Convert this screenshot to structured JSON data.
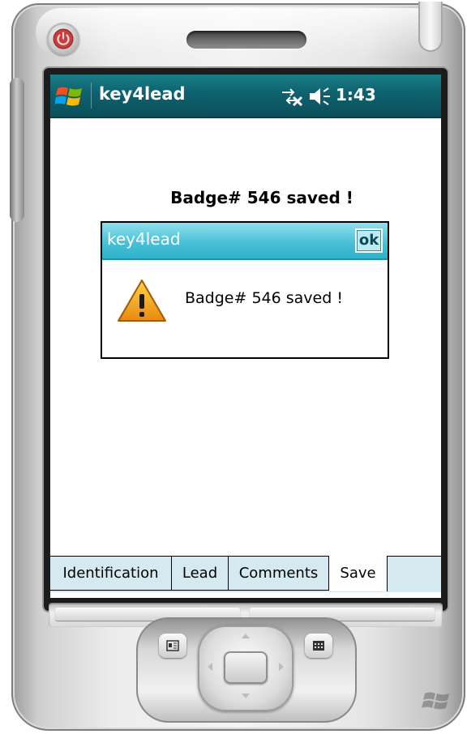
{
  "status_bar": {
    "app_title": "key4lead",
    "time": "1:43",
    "icons": [
      "windows-start-icon",
      "connectivity-icon",
      "volume-icon"
    ]
  },
  "main": {
    "headline": "Badge# 546 saved !"
  },
  "dialog": {
    "title": "key4lead",
    "ok_label": "ok",
    "message": "Badge# 546 saved !",
    "icon": "warning-icon"
  },
  "tabs": [
    {
      "label": "Identification",
      "active": false
    },
    {
      "label": "Lead",
      "active": false
    },
    {
      "label": "Comments",
      "active": false
    },
    {
      "label": "Save",
      "active": true
    }
  ],
  "hardware": {
    "icons": [
      "power-icon",
      "contacts-icon",
      "calendar-icon",
      "windows-logo-icon"
    ]
  },
  "colors": {
    "titlebar": "#0f6370",
    "dialog_titlebar": "#49c1d8",
    "tabbar": "#d5e9f1",
    "warning": "#f0a020"
  }
}
